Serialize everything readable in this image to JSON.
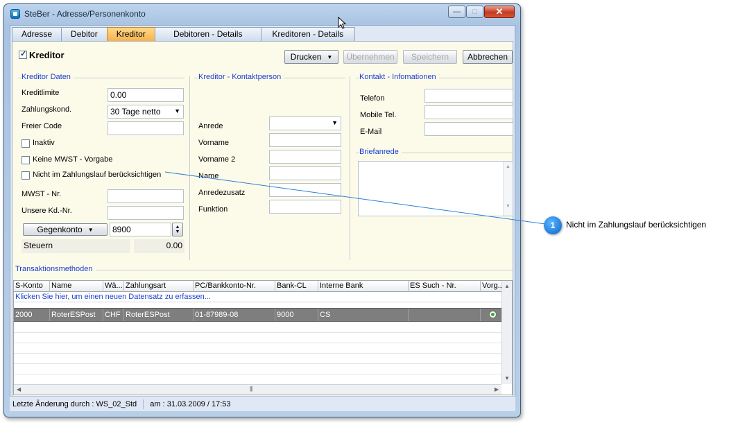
{
  "window": {
    "title": "SteBer - Adresse/Personenkonto",
    "controls": {
      "minimize": "—",
      "maximize": "□",
      "close": "✕"
    }
  },
  "tabs": [
    {
      "label": "Adresse"
    },
    {
      "label": "Debitor"
    },
    {
      "label": "Kreditor",
      "active": true
    },
    {
      "label": "Debitoren - Details"
    },
    {
      "label": "Kreditoren - Details"
    }
  ],
  "header": {
    "kreditor_label": "Kreditor",
    "kreditor_checked": true,
    "buttons": {
      "drucken": "Drucken",
      "uebernehmen": "Übernehmen",
      "speichern": "Speichern",
      "abbrechen": "Abbrechen"
    }
  },
  "kreditor_daten": {
    "title": "Kreditor Daten",
    "kreditlimite_label": "Kreditlimite",
    "kreditlimite_value": "0.00",
    "zahlungskond_label": "Zahlungskond.",
    "zahlungskond_value": "30 Tage netto",
    "freier_code_label": "Freier Code",
    "freier_code_value": "",
    "inaktiv_label": "Inaktiv",
    "keine_mwst_label": "Keine MWST - Vorgabe",
    "nicht_zahlungslauf_label": "Nicht im Zahlungslauf berücksichtigen",
    "mwst_nr_label": "MWST - Nr.",
    "unsere_kd_nr_label": "Unsere Kd.-Nr.",
    "gegenkonto_button": "Gegenkonto",
    "gegenkonto_value": "8900",
    "steuern_label": "Steuern",
    "steuern_value": "0.00"
  },
  "kontaktperson": {
    "title": "Kreditor - Kontaktperson",
    "anrede_label": "Anrede",
    "vorname_label": "Vorname",
    "vorname2_label": "Vorname 2",
    "name_label": "Name",
    "anredezusatz_label": "Anredezusatz",
    "funktion_label": "Funktion"
  },
  "kontakt_info": {
    "title": "Kontakt - Infomationen",
    "telefon_label": "Telefon",
    "mobile_label": "Mobile Tel.",
    "email_label": "E-Mail",
    "briefanrede_title": "Briefanrede"
  },
  "transaktionen": {
    "title": "Transaktionsmethoden",
    "columns": [
      "S-Konto",
      "Name",
      "Wä...",
      "Zahlungsart",
      "PC/Bankkonto-Nr.",
      "Bank-CL",
      "Interne Bank",
      "ES Such - Nr.",
      "Vorg..."
    ],
    "new_row_hint": "Klicken Sie hier, um einen neuen Datensatz zu erfassen...",
    "rows": [
      [
        "2000",
        "RoterESPost",
        "CHF",
        "RoterESPost",
        "01-87989-08",
        "9000",
        "CS",
        "",
        ""
      ]
    ]
  },
  "statusbar": {
    "letzte_aenderung": "Letzte Änderung durch : WS_02_Std",
    "am": "am : 31.03.2009 / 17:53"
  },
  "callout": {
    "number": "1",
    "text": "Nicht im Zahlungslauf berücksichtigen"
  },
  "colors": {
    "accent_tab": "#f7b24c",
    "group_title": "#1b3fd0",
    "selected_row": "#7e7e7e",
    "callout": "#0a62c9"
  }
}
